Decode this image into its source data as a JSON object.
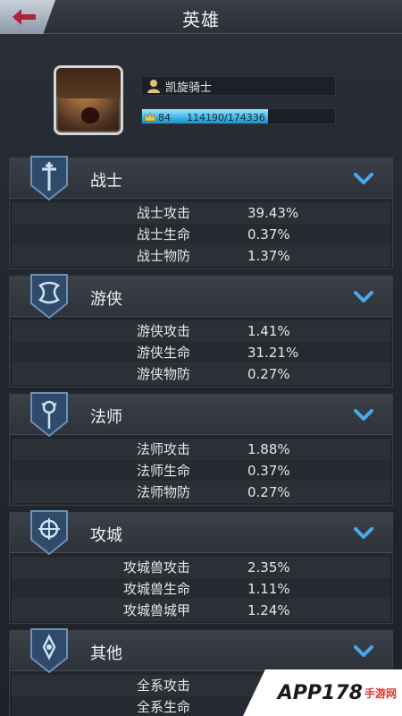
{
  "header": {
    "title": "英雄"
  },
  "hero": {
    "name": "凯旋骑士",
    "level": "84",
    "exp_text": "114190/174336",
    "exp_current": 114190,
    "exp_max": 174336
  },
  "sections": [
    {
      "title": "战士",
      "emblem": "warrior-emblem-icon",
      "stats": [
        {
          "label": "战士攻击",
          "value": "39.43%"
        },
        {
          "label": "战士生命",
          "value": "0.37%"
        },
        {
          "label": "战士物防",
          "value": "1.37%"
        }
      ]
    },
    {
      "title": "游侠",
      "emblem": "ranger-emblem-icon",
      "stats": [
        {
          "label": "游侠攻击",
          "value": "1.41%"
        },
        {
          "label": "游侠生命",
          "value": "31.21%"
        },
        {
          "label": "游侠物防",
          "value": "0.27%"
        }
      ]
    },
    {
      "title": "法师",
      "emblem": "mage-emblem-icon",
      "stats": [
        {
          "label": "法师攻击",
          "value": "1.88%"
        },
        {
          "label": "法师生命",
          "value": "0.37%"
        },
        {
          "label": "法师物防",
          "value": "0.27%"
        }
      ]
    },
    {
      "title": "攻城",
      "emblem": "siege-emblem-icon",
      "stats": [
        {
          "label": "攻城兽攻击",
          "value": "2.35%"
        },
        {
          "label": "攻城兽生命",
          "value": "1.11%"
        },
        {
          "label": "攻城兽城甲",
          "value": "1.24%"
        }
      ]
    },
    {
      "title": "其他",
      "emblem": "other-emblem-icon",
      "stats": [
        {
          "label": "全系攻击",
          "value": ""
        },
        {
          "label": "全系生命",
          "value": ""
        }
      ]
    }
  ],
  "watermark": {
    "text": "APP178",
    "sub": "手游网"
  },
  "colors": {
    "accent": "#3fb8e8",
    "chevron": "#4aa9e8",
    "emblem": "#2f4a6b"
  }
}
